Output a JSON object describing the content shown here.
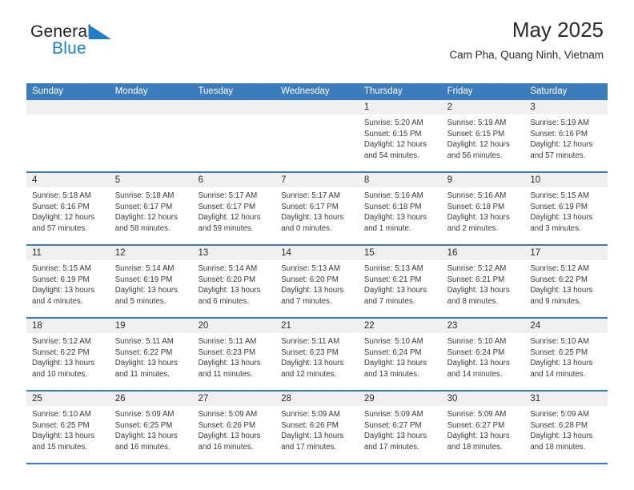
{
  "brand": {
    "name_part1": "General",
    "name_part2": "Blue",
    "flag_color": "#1f7fc4"
  },
  "header": {
    "month_title": "May 2025",
    "location": "Cam Pha, Quang Ninh, Vietnam"
  },
  "theme": {
    "header_blue": "#3b7cbd",
    "day_band_gray": "#f0f0f0",
    "text_color": "#2b2b2b"
  },
  "calendar": {
    "weekdays": [
      "Sunday",
      "Monday",
      "Tuesday",
      "Wednesday",
      "Thursday",
      "Friday",
      "Saturday"
    ],
    "weeks": [
      [
        {
          "day": "",
          "sunrise": "",
          "sunset": "",
          "daylight1": "",
          "daylight2": ""
        },
        {
          "day": "",
          "sunrise": "",
          "sunset": "",
          "daylight1": "",
          "daylight2": ""
        },
        {
          "day": "",
          "sunrise": "",
          "sunset": "",
          "daylight1": "",
          "daylight2": ""
        },
        {
          "day": "",
          "sunrise": "",
          "sunset": "",
          "daylight1": "",
          "daylight2": ""
        },
        {
          "day": "1",
          "sunrise": "Sunrise: 5:20 AM",
          "sunset": "Sunset: 6:15 PM",
          "daylight1": "Daylight: 12 hours",
          "daylight2": "and 54 minutes."
        },
        {
          "day": "2",
          "sunrise": "Sunrise: 5:19 AM",
          "sunset": "Sunset: 6:15 PM",
          "daylight1": "Daylight: 12 hours",
          "daylight2": "and 56 minutes."
        },
        {
          "day": "3",
          "sunrise": "Sunrise: 5:19 AM",
          "sunset": "Sunset: 6:16 PM",
          "daylight1": "Daylight: 12 hours",
          "daylight2": "and 57 minutes."
        }
      ],
      [
        {
          "day": "4",
          "sunrise": "Sunrise: 5:18 AM",
          "sunset": "Sunset: 6:16 PM",
          "daylight1": "Daylight: 12 hours",
          "daylight2": "and 57 minutes."
        },
        {
          "day": "5",
          "sunrise": "Sunrise: 5:18 AM",
          "sunset": "Sunset: 6:17 PM",
          "daylight1": "Daylight: 12 hours",
          "daylight2": "and 58 minutes."
        },
        {
          "day": "6",
          "sunrise": "Sunrise: 5:17 AM",
          "sunset": "Sunset: 6:17 PM",
          "daylight1": "Daylight: 12 hours",
          "daylight2": "and 59 minutes."
        },
        {
          "day": "7",
          "sunrise": "Sunrise: 5:17 AM",
          "sunset": "Sunset: 6:17 PM",
          "daylight1": "Daylight: 13 hours",
          "daylight2": "and 0 minutes."
        },
        {
          "day": "8",
          "sunrise": "Sunrise: 5:16 AM",
          "sunset": "Sunset: 6:18 PM",
          "daylight1": "Daylight: 13 hours",
          "daylight2": "and 1 minute."
        },
        {
          "day": "9",
          "sunrise": "Sunrise: 5:16 AM",
          "sunset": "Sunset: 6:18 PM",
          "daylight1": "Daylight: 13 hours",
          "daylight2": "and 2 minutes."
        },
        {
          "day": "10",
          "sunrise": "Sunrise: 5:15 AM",
          "sunset": "Sunset: 6:19 PM",
          "daylight1": "Daylight: 13 hours",
          "daylight2": "and 3 minutes."
        }
      ],
      [
        {
          "day": "11",
          "sunrise": "Sunrise: 5:15 AM",
          "sunset": "Sunset: 6:19 PM",
          "daylight1": "Daylight: 13 hours",
          "daylight2": "and 4 minutes."
        },
        {
          "day": "12",
          "sunrise": "Sunrise: 5:14 AM",
          "sunset": "Sunset: 6:19 PM",
          "daylight1": "Daylight: 13 hours",
          "daylight2": "and 5 minutes."
        },
        {
          "day": "13",
          "sunrise": "Sunrise: 5:14 AM",
          "sunset": "Sunset: 6:20 PM",
          "daylight1": "Daylight: 13 hours",
          "daylight2": "and 6 minutes."
        },
        {
          "day": "14",
          "sunrise": "Sunrise: 5:13 AM",
          "sunset": "Sunset: 6:20 PM",
          "daylight1": "Daylight: 13 hours",
          "daylight2": "and 7 minutes."
        },
        {
          "day": "15",
          "sunrise": "Sunrise: 5:13 AM",
          "sunset": "Sunset: 6:21 PM",
          "daylight1": "Daylight: 13 hours",
          "daylight2": "and 7 minutes."
        },
        {
          "day": "16",
          "sunrise": "Sunrise: 5:12 AM",
          "sunset": "Sunset: 6:21 PM",
          "daylight1": "Daylight: 13 hours",
          "daylight2": "and 8 minutes."
        },
        {
          "day": "17",
          "sunrise": "Sunrise: 5:12 AM",
          "sunset": "Sunset: 6:22 PM",
          "daylight1": "Daylight: 13 hours",
          "daylight2": "and 9 minutes."
        }
      ],
      [
        {
          "day": "18",
          "sunrise": "Sunrise: 5:12 AM",
          "sunset": "Sunset: 6:22 PM",
          "daylight1": "Daylight: 13 hours",
          "daylight2": "and 10 minutes."
        },
        {
          "day": "19",
          "sunrise": "Sunrise: 5:11 AM",
          "sunset": "Sunset: 6:22 PM",
          "daylight1": "Daylight: 13 hours",
          "daylight2": "and 11 minutes."
        },
        {
          "day": "20",
          "sunrise": "Sunrise: 5:11 AM",
          "sunset": "Sunset: 6:23 PM",
          "daylight1": "Daylight: 13 hours",
          "daylight2": "and 11 minutes."
        },
        {
          "day": "21",
          "sunrise": "Sunrise: 5:11 AM",
          "sunset": "Sunset: 6:23 PM",
          "daylight1": "Daylight: 13 hours",
          "daylight2": "and 12 minutes."
        },
        {
          "day": "22",
          "sunrise": "Sunrise: 5:10 AM",
          "sunset": "Sunset: 6:24 PM",
          "daylight1": "Daylight: 13 hours",
          "daylight2": "and 13 minutes."
        },
        {
          "day": "23",
          "sunrise": "Sunrise: 5:10 AM",
          "sunset": "Sunset: 6:24 PM",
          "daylight1": "Daylight: 13 hours",
          "daylight2": "and 14 minutes."
        },
        {
          "day": "24",
          "sunrise": "Sunrise: 5:10 AM",
          "sunset": "Sunset: 6:25 PM",
          "daylight1": "Daylight: 13 hours",
          "daylight2": "and 14 minutes."
        }
      ],
      [
        {
          "day": "25",
          "sunrise": "Sunrise: 5:10 AM",
          "sunset": "Sunset: 6:25 PM",
          "daylight1": "Daylight: 13 hours",
          "daylight2": "and 15 minutes."
        },
        {
          "day": "26",
          "sunrise": "Sunrise: 5:09 AM",
          "sunset": "Sunset: 6:25 PM",
          "daylight1": "Daylight: 13 hours",
          "daylight2": "and 16 minutes."
        },
        {
          "day": "27",
          "sunrise": "Sunrise: 5:09 AM",
          "sunset": "Sunset: 6:26 PM",
          "daylight1": "Daylight: 13 hours",
          "daylight2": "and 16 minutes."
        },
        {
          "day": "28",
          "sunrise": "Sunrise: 5:09 AM",
          "sunset": "Sunset: 6:26 PM",
          "daylight1": "Daylight: 13 hours",
          "daylight2": "and 17 minutes."
        },
        {
          "day": "29",
          "sunrise": "Sunrise: 5:09 AM",
          "sunset": "Sunset: 6:27 PM",
          "daylight1": "Daylight: 13 hours",
          "daylight2": "and 17 minutes."
        },
        {
          "day": "30",
          "sunrise": "Sunrise: 5:09 AM",
          "sunset": "Sunset: 6:27 PM",
          "daylight1": "Daylight: 13 hours",
          "daylight2": "and 18 minutes."
        },
        {
          "day": "31",
          "sunrise": "Sunrise: 5:09 AM",
          "sunset": "Sunset: 6:28 PM",
          "daylight1": "Daylight: 13 hours",
          "daylight2": "and 18 minutes."
        }
      ]
    ]
  }
}
